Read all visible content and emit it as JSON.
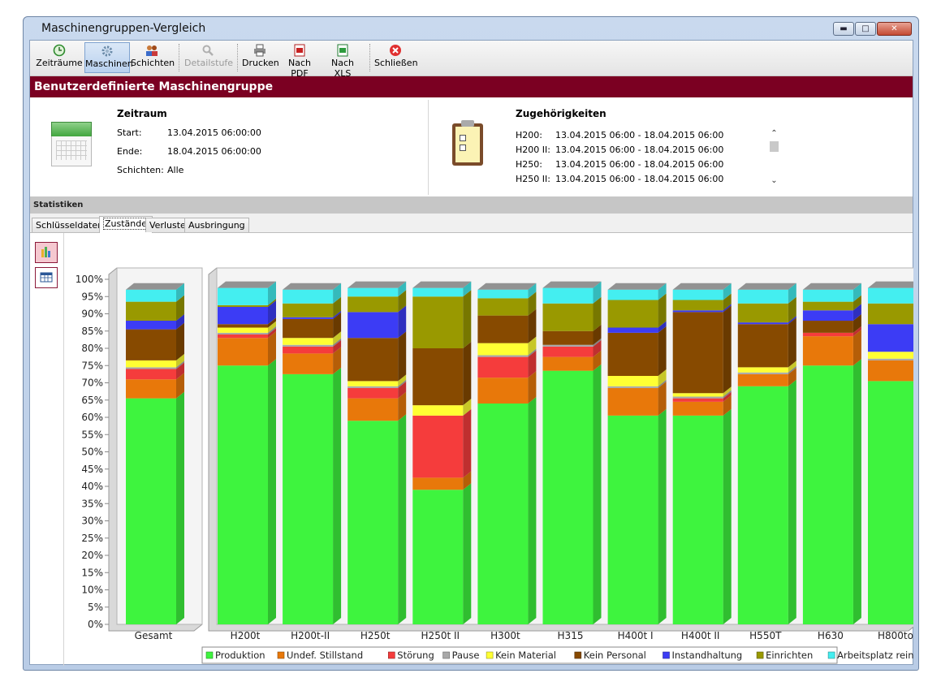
{
  "window": {
    "title": "Maschinengruppen-Vergleich",
    "min_icon": "minimize-icon",
    "max_icon": "maximize-icon",
    "close_icon": "close-icon"
  },
  "toolbar": {
    "buttons": [
      {
        "label": "Zeiträume",
        "icon": "clock-icon",
        "state": "normal"
      },
      {
        "label": "Maschinen",
        "icon": "gear-icon",
        "state": "active"
      },
      {
        "label": "Schichten",
        "icon": "people-icon",
        "state": "normal"
      },
      {
        "label": "Detailstufe",
        "icon": "magnifier-icon",
        "state": "disabled"
      },
      {
        "label": "Drucken",
        "icon": "printer-icon",
        "state": "normal"
      },
      {
        "label": "Nach PDF",
        "icon": "pdf-icon",
        "state": "normal"
      },
      {
        "label": "Nach XLS",
        "icon": "excel-icon",
        "state": "normal"
      },
      {
        "label": "Schließen",
        "icon": "close-red-icon",
        "state": "normal"
      }
    ]
  },
  "banner": {
    "title": "Benutzerdefinierte Maschinengruppe"
  },
  "zeitraum": {
    "title": "Zeitraum",
    "start_label": "Start:",
    "start_value": "13.04.2015 06:00:00",
    "end_label": "Ende:",
    "end_value": "18.04.2015 06:00:00",
    "shifts_label": "Schichten:",
    "shifts_value": "Alle"
  },
  "zugehoerigkeiten": {
    "title": "Zugehörigkeiten",
    "rows": [
      {
        "machine": "H200:",
        "range": "13.04.2015 06:00 - 18.04.2015 06:00"
      },
      {
        "machine": "H200 II:",
        "range": "13.04.2015 06:00 - 18.04.2015 06:00"
      },
      {
        "machine": "H250:",
        "range": "13.04.2015 06:00 - 18.04.2015 06:00"
      },
      {
        "machine": "H250 II:",
        "range": "13.04.2015 06:00 - 18.04.2015 06:00"
      }
    ]
  },
  "statistiken": {
    "label": "Statistiken"
  },
  "tabs": [
    "Schlüsseldaten",
    "Zustände",
    "Verluste",
    "Ausbringung"
  ],
  "active_tab": "Zustände",
  "side_buttons": [
    "bar-chart-icon",
    "table-icon"
  ],
  "chart_data": {
    "type": "bar",
    "stacked": true,
    "percent": true,
    "ylim": [
      0,
      100
    ],
    "yticks": [
      "0%",
      "5%",
      "10%",
      "15%",
      "20%",
      "25%",
      "30%",
      "35%",
      "40%",
      "45%",
      "50%",
      "55%",
      "60%",
      "65%",
      "70%",
      "75%",
      "80%",
      "85%",
      "90%",
      "95%",
      "100%"
    ],
    "legend_position": "bottom",
    "categories": [
      "Gesamt",
      "H200t",
      "H200t-II",
      "H250t",
      "H250t II",
      "H300t",
      "H315",
      "H400t I",
      "H400t II",
      "H550T",
      "H630",
      "H800to"
    ],
    "series": [
      {
        "name": "Produktion",
        "color": "#3ef43e",
        "values": [
          65.5,
          75,
          72.5,
          59,
          39,
          64,
          73.5,
          60.5,
          60.5,
          69,
          75,
          70.5
        ]
      },
      {
        "name": "Undef. Stillstand",
        "color": "#e8780a",
        "values": [
          5.5,
          8,
          6,
          6.5,
          3.5,
          7.5,
          4,
          8,
          4,
          3.5,
          8.5,
          6
        ]
      },
      {
        "name": "Störung",
        "color": "#f53c3c",
        "values": [
          3,
          1,
          2,
          3,
          18,
          6,
          3,
          0,
          1,
          0,
          1,
          0
        ]
      },
      {
        "name": "Pause",
        "color": "#a8a8a8",
        "values": [
          0.5,
          0.5,
          0.5,
          0.5,
          0,
          0.5,
          0.5,
          0.5,
          0.5,
          0.5,
          0,
          0.5
        ]
      },
      {
        "name": "Kein Material",
        "color": "#ffff33",
        "values": [
          2,
          1.5,
          2,
          1.5,
          3,
          3.5,
          0,
          3,
          1,
          1.5,
          0,
          2
        ]
      },
      {
        "name": "Kein Personal",
        "color": "#874a00",
        "values": [
          9,
          1,
          5.5,
          12.5,
          16.5,
          8,
          4,
          12.5,
          23.5,
          12.5,
          3.5,
          0
        ]
      },
      {
        "name": "Instandhaltung",
        "color": "#3c3cf5",
        "values": [
          2.5,
          5,
          0.5,
          7.5,
          0,
          0,
          0,
          1.5,
          0.5,
          0.5,
          3,
          8
        ]
      },
      {
        "name": "Einrichten",
        "color": "#999900",
        "values": [
          5.5,
          0.5,
          4,
          4.5,
          15,
          5,
          8,
          8,
          3,
          5.5,
          2.5,
          6
        ]
      },
      {
        "name": "Arbeitsplatz reinigen",
        "color": "#44eef0",
        "values": [
          3.5,
          5,
          4,
          2.5,
          2.5,
          2.5,
          4.5,
          3,
          3,
          4,
          3.5,
          4.5
        ]
      }
    ]
  }
}
